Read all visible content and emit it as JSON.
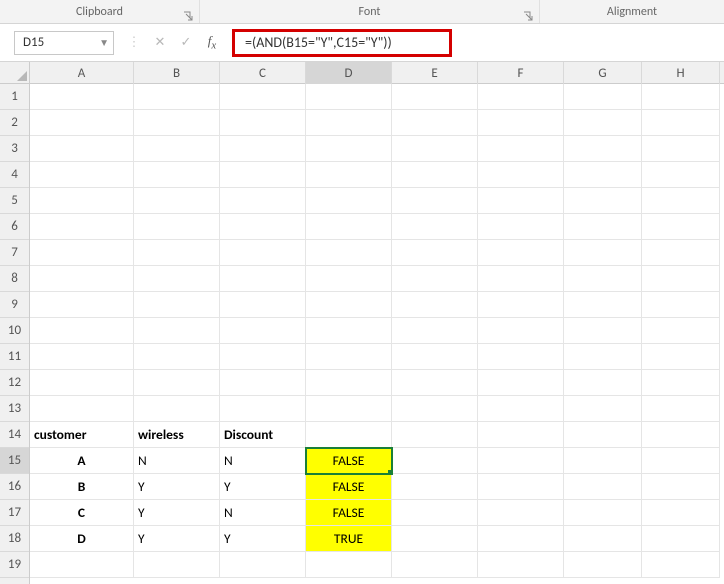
{
  "ribbon": {
    "groups": [
      "Clipboard",
      "Font",
      "Alignment"
    ]
  },
  "nameBox": "D15",
  "formula": "=(AND(B15=\"Y\",C15=\"Y\"))",
  "columns": [
    "A",
    "B",
    "C",
    "D",
    "E",
    "F",
    "G",
    "H"
  ],
  "rowCount": 19,
  "selectedCell": {
    "row": 15,
    "col": "D"
  },
  "cells": {
    "r14": {
      "A": "customer",
      "B": "wireless",
      "C": "Discount"
    },
    "r15": {
      "A": "A",
      "B": "N",
      "C": "N",
      "D": "FALSE"
    },
    "r16": {
      "A": "B",
      "B": "Y",
      "C": "Y",
      "D": "FALSE"
    },
    "r17": {
      "A": "C",
      "B": "Y",
      "C": "N",
      "D": "FALSE"
    },
    "r18": {
      "A": "D",
      "B": "Y",
      "C": "Y",
      "D": "TRUE"
    }
  }
}
